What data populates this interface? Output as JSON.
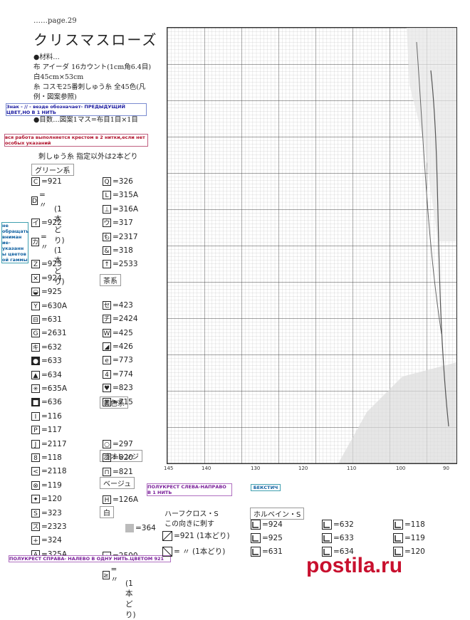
{
  "header": {
    "page_label": "……page.29",
    "title": "クリスマスローズ"
  },
  "materials": [
    "●材料…",
    "布 アイーダ 16カウント(1cm角6.4目)",
    "白45cm×53cm",
    "糸 コスモ25番刺しゅう糸 全45色(凡",
    "例・図案参照)",
    "●目数…図案1マス=布目1目×1目"
  ],
  "notes": {
    "prev_color": "Знак - // - везде обозначает- ПРЕДЫДУЩИЙ ЦВЕТ,НО В 1 НИТЬ",
    "two_strands": "вся работа выполняется крестом в 2 нитки,если нет особых указаний",
    "ignore_numbers": "не обращать вниман ие- указанн ы цветов ой гаммы",
    "half_left": "ПОЛУКРЕСТ СЛЕВА-НАПРАВО В 1 НИТЬ",
    "backstitch": "БЕКСТИЧ",
    "half_right": "ПОЛУКРЕСТ СПРАВА- НАЛЕВО В ОДНУ НИТЬ.ЦВЕТОМ 921"
  },
  "thread_note": "刺しゅう糸 指定以外は2本どり",
  "categories": {
    "green": "グリーン系",
    "brown": "茶系",
    "yellow": "黄色系",
    "orange": "淡オレンジ",
    "beige": "ベージュ",
    "white": "白"
  },
  "left_col": [
    {
      "sym": "C",
      "val": "=921"
    },
    {
      "sym": "D",
      "val": "= 〃"
    },
    {
      "sym": "",
      "val": "(1本どり)"
    },
    {
      "sym": "イ",
      "val": "=922"
    },
    {
      "sym": "カ",
      "val": "= 〃"
    },
    {
      "sym": "",
      "val": "(1本どり)"
    },
    {
      "sym": "Z",
      "val": "=923"
    },
    {
      "sym": "✕",
      "val": "=924"
    },
    {
      "sym": "◒",
      "val": "=925"
    },
    {
      "sym": "Y",
      "val": "=630A"
    },
    {
      "sym": "⊟",
      "val": "=631"
    },
    {
      "sym": "G",
      "val": "=2631"
    },
    {
      "sym": "キ",
      "val": "=632"
    },
    {
      "sym": "●",
      "val": "=633"
    },
    {
      "sym": "▲",
      "val": "=634"
    },
    {
      "sym": "✳",
      "val": "=635A"
    },
    {
      "sym": "■",
      "val": "=636"
    },
    {
      "sym": "I",
      "val": "=116"
    },
    {
      "sym": "P",
      "val": "=117"
    },
    {
      "sym": "J",
      "val": "=2117"
    },
    {
      "sym": "8",
      "val": "=118"
    },
    {
      "sym": "<",
      "val": "=2118"
    },
    {
      "sym": "⊗",
      "val": "=119"
    },
    {
      "sym": "✦",
      "val": "=120"
    },
    {
      "sym": "S",
      "val": "=323"
    },
    {
      "sym": "ス",
      "val": "=2323"
    },
    {
      "sym": "+",
      "val": "=324"
    },
    {
      "sym": "A",
      "val": "=325A"
    }
  ],
  "right_col": [
    {
      "sym": "Q",
      "val": "=326"
    },
    {
      "sym": "L",
      "val": "=315A"
    },
    {
      "sym": "⊥",
      "val": "=316A"
    },
    {
      "sym": "ウ",
      "val": "=317"
    },
    {
      "sym": "も",
      "val": "=2317"
    },
    {
      "sym": "&",
      "val": "=318"
    },
    {
      "sym": "↑",
      "val": "=2533"
    },
    {
      "sym": "セ",
      "val": "=423"
    },
    {
      "sym": "チ",
      "val": "=2424"
    },
    {
      "sym": "W",
      "val": "=425"
    },
    {
      "sym": "◢",
      "val": "=426"
    },
    {
      "sym": "e",
      "val": "=773"
    },
    {
      "sym": "4",
      "val": "=774"
    },
    {
      "sym": "♥",
      "val": "=823"
    },
    {
      "sym": "#",
      "val": "=715"
    },
    {
      "sym": "○",
      "val": "=297"
    },
    {
      "sym": "コ",
      "val": "=820"
    },
    {
      "sym": "⊓",
      "val": "=821"
    },
    {
      "sym": "H",
      "val": "=126A"
    },
    {
      "sym": "",
      "val": "=364"
    },
    {
      "sym": "・",
      "val": "=2500"
    },
    {
      "sym": "≥",
      "val": "= 〃"
    },
    {
      "sym": "",
      "val": "(1本どり)"
    }
  ],
  "half_cross": {
    "title": "ハーフクロス・S",
    "sub": "この向きに刺す",
    "row1": "=921 (1本どり)",
    "row2": "= 〃 (1本どり)"
  },
  "holbein": {
    "title": "ホルベイン・S",
    "items": [
      {
        "val": "=924"
      },
      {
        "val": "=925"
      },
      {
        "val": "=631"
      },
      {
        "val": "=632"
      },
      {
        "val": "=633"
      },
      {
        "val": "=634"
      },
      {
        "val": "=118"
      },
      {
        "val": "=119"
      },
      {
        "val": "=120"
      }
    ]
  },
  "x_ticks": [
    "140",
    "130",
    "120",
    "110",
    "100",
    "90"
  ],
  "x_tick_left": "145",
  "watermark": "postila.ru"
}
